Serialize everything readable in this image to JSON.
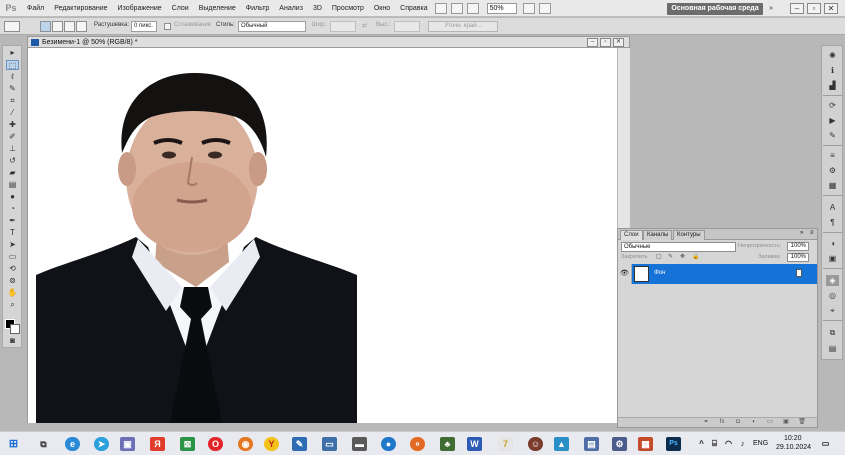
{
  "app": {
    "logo": "Ps"
  },
  "menu": [
    "Файл",
    "Редактирование",
    "Изображение",
    "Слои",
    "Выделение",
    "Фильтр",
    "Анализ",
    "3D",
    "Просмотр",
    "Окно",
    "Справка"
  ],
  "zoom": {
    "value": "50%"
  },
  "workspace": {
    "label": "Основная рабочая среда",
    "arrow": "»"
  },
  "window_controls": {
    "minimize": "–",
    "restore": "▫",
    "close": "✕"
  },
  "options": {
    "feather_label": "Растушевка:",
    "feather_value": "0 пикс.",
    "antialias_label": "Сглаживание",
    "style_label": "Стиль:",
    "style_value": "Обычный",
    "width_label": "Шир.:",
    "height_label": "Выс.:",
    "refine_label": "Уточн. край..."
  },
  "document": {
    "title": "Безимени-1 @ 50% (RGB/8) *"
  },
  "layers_panel": {
    "tabs": [
      "Слои",
      "Каналы",
      "Контуры"
    ],
    "blend_mode": "Обычные",
    "opacity_label": "Непрозрачность:",
    "opacity_value": "100%",
    "lock_label": "Закрепить:",
    "fill_label": "Заливка:",
    "fill_value": "100%",
    "layer_name": "Фон"
  },
  "taskbar": {
    "lang": "ENG",
    "time": "10:20",
    "date": "29.10.2024"
  },
  "colors": {
    "accent": "#1572d6",
    "suit": "#101217",
    "shirt": "#f4f6fa",
    "tie": "#0a0b0e"
  }
}
